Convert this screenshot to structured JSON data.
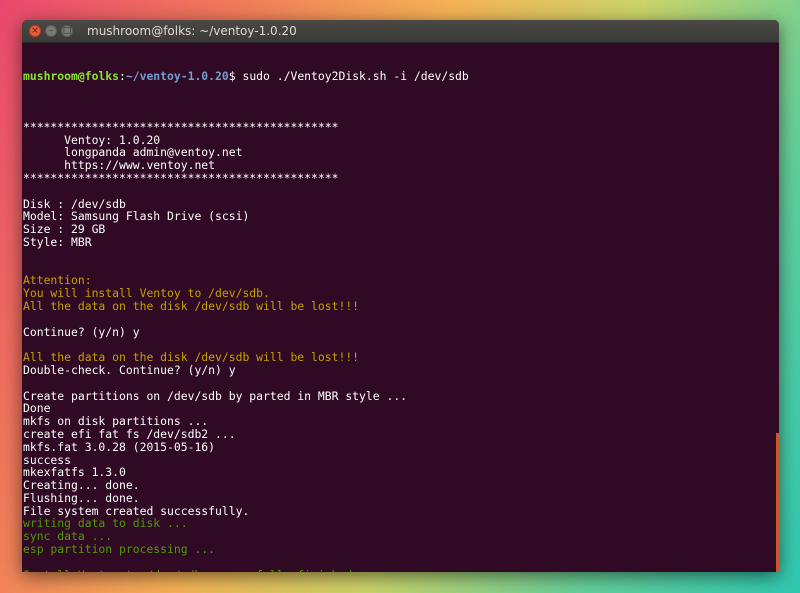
{
  "window": {
    "title": "mushroom@folks: ~/ventoy-1.0.20",
    "close_glyph": "×",
    "min_glyph": "–",
    "max_glyph": "□"
  },
  "colors": {
    "prompt_user": "#8ae234",
    "prompt_path": "#729fcf",
    "warning": "#c4a000",
    "success": "#4e9a06",
    "text": "#ffffff",
    "background": "#300a24"
  },
  "terminal": {
    "prompt": {
      "user": "mushroom@folks",
      "sep": ":",
      "path": "~/ventoy-1.0.20",
      "symbol": "$",
      "command": " sudo ./Ventoy2Disk.sh -i /dev/sdb"
    },
    "lines": [
      {
        "text": "",
        "kind": "normal"
      },
      {
        "text": "**********************************************",
        "kind": "normal"
      },
      {
        "text": "      Ventoy: 1.0.20",
        "kind": "normal"
      },
      {
        "text": "      longpanda admin@ventoy.net",
        "kind": "normal"
      },
      {
        "text": "      https://www.ventoy.net",
        "kind": "normal"
      },
      {
        "text": "**********************************************",
        "kind": "normal"
      },
      {
        "text": "",
        "kind": "normal"
      },
      {
        "text": "Disk : /dev/sdb",
        "kind": "normal"
      },
      {
        "text": "Model: Samsung Flash Drive (scsi)",
        "kind": "normal"
      },
      {
        "text": "Size : 29 GB",
        "kind": "normal"
      },
      {
        "text": "Style: MBR",
        "kind": "normal"
      },
      {
        "text": "",
        "kind": "normal"
      },
      {
        "text": "",
        "kind": "normal"
      },
      {
        "text": "Attention:",
        "kind": "warning"
      },
      {
        "text": "You will install Ventoy to /dev/sdb.",
        "kind": "warning"
      },
      {
        "text": "All the data on the disk /dev/sdb will be lost!!!",
        "kind": "warning"
      },
      {
        "text": "",
        "kind": "normal"
      },
      {
        "text": "Continue? (y/n) y",
        "kind": "normal"
      },
      {
        "text": "",
        "kind": "normal"
      },
      {
        "text": "All the data on the disk /dev/sdb will be lost!!!",
        "kind": "warning"
      },
      {
        "text": "Double-check. Continue? (y/n) y",
        "kind": "normal"
      },
      {
        "text": "",
        "kind": "normal"
      },
      {
        "text": "Create partitions on /dev/sdb by parted in MBR style ...",
        "kind": "normal"
      },
      {
        "text": "Done",
        "kind": "normal"
      },
      {
        "text": "mkfs on disk partitions ...",
        "kind": "normal"
      },
      {
        "text": "create efi fat fs /dev/sdb2 ...",
        "kind": "normal"
      },
      {
        "text": "mkfs.fat 3.0.28 (2015-05-16)",
        "kind": "normal"
      },
      {
        "text": "success",
        "kind": "normal"
      },
      {
        "text": "mkexfatfs 1.3.0",
        "kind": "normal"
      },
      {
        "text": "Creating... done.",
        "kind": "normal"
      },
      {
        "text": "Flushing... done.",
        "kind": "normal"
      },
      {
        "text": "File system created successfully.",
        "kind": "normal"
      },
      {
        "text": "writing data to disk ...",
        "kind": "success"
      },
      {
        "text": "sync data ...",
        "kind": "success"
      },
      {
        "text": "esp partition processing ...",
        "kind": "success"
      },
      {
        "text": "",
        "kind": "normal"
      },
      {
        "text": "Install Ventoy to /dev/sdb successfully finished.",
        "kind": "success"
      }
    ]
  }
}
